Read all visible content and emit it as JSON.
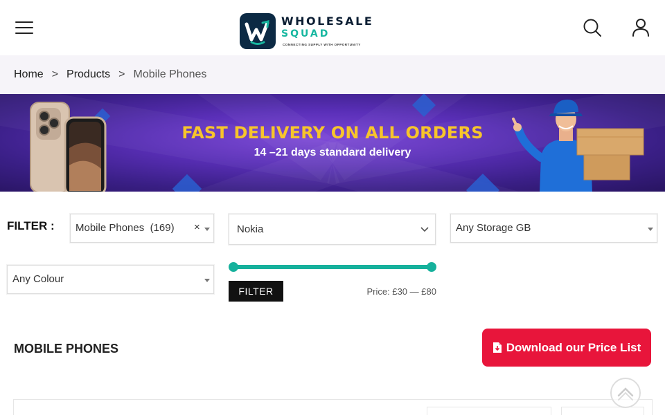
{
  "header": {
    "menu_icon": "hamburger-icon",
    "logo": {
      "word1": "WHOLESALE",
      "word2": "SQUAD",
      "tagline": "CONNECTING SUPPLY WITH OPPORTUNITY"
    },
    "search_icon": "search-icon",
    "account_icon": "user-icon"
  },
  "breadcrumb": {
    "home": "Home",
    "separator": ">",
    "products": "Products",
    "current": "Mobile Phones"
  },
  "banner": {
    "headline": "FAST DELIVERY ON ALL ORDERS",
    "subline": "14 –21 days standard delivery"
  },
  "filters": {
    "label": "FILTER :",
    "category": {
      "value": "Mobile Phones  (169)",
      "clear": "×"
    },
    "brand": {
      "value": "Nokia"
    },
    "storage": {
      "value": "Any Storage GB"
    },
    "colour": {
      "value": "Any Colour"
    },
    "price_slider": {
      "min_value": 30,
      "max_value": 80
    },
    "filter_button": "FILTER",
    "price_label": "Price:",
    "price_min": "£30",
    "price_dash": "—",
    "price_max": "£80"
  },
  "section": {
    "title": "MOBILE PHONES",
    "download_button": "Download our Price List",
    "download_icon": "file-download-icon",
    "scroll_top_icon": "chevron-up-icon"
  },
  "colors": {
    "accent_teal": "#16b19c",
    "download_red": "#e8153b",
    "banner_purple": "#5a2fb8",
    "banner_yellow": "#f7c52b"
  }
}
